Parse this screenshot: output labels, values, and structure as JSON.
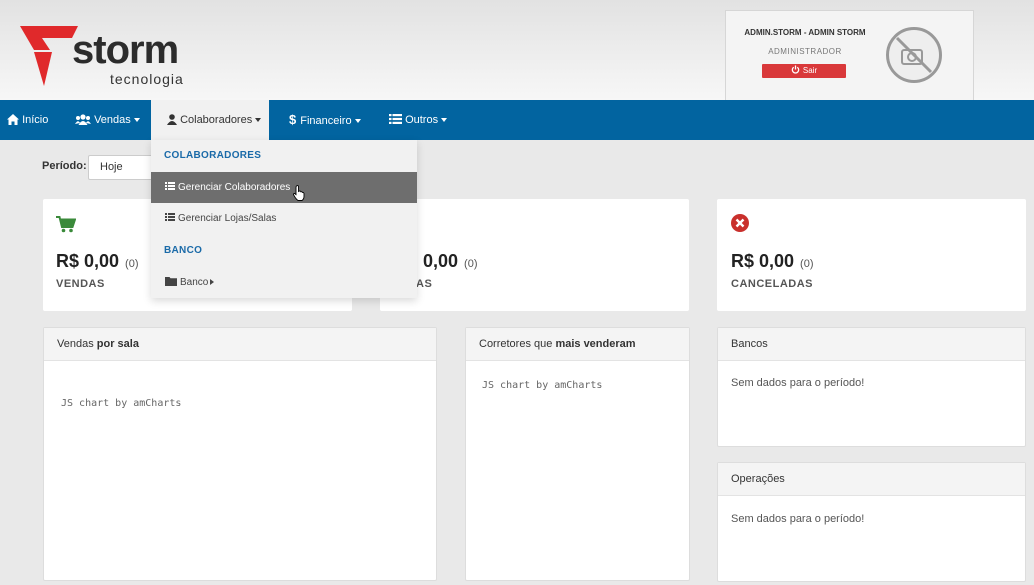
{
  "brand": {
    "name": "storm",
    "tagline": "tecnologia",
    "mark_color": "#e0292b"
  },
  "user": {
    "name": "ADMIN.STORM - ADMIN STORM",
    "role": "ADMINISTRADOR",
    "logout_label": "Sair"
  },
  "nav": {
    "items": [
      {
        "label": "Início",
        "icon": "home-icon"
      },
      {
        "label": "Vendas",
        "icon": "users-icon"
      },
      {
        "label": "Colaboradores",
        "icon": "user-icon",
        "open": true
      },
      {
        "label": "Financeiro",
        "icon": "dollar-icon"
      },
      {
        "label": "Outros",
        "icon": "list-icon"
      }
    ]
  },
  "dropdown": {
    "section1": "COLABORADORES",
    "item1": "Gerenciar Colaboradores",
    "item2": "Gerenciar Lojas/Salas",
    "section2": "BANCO",
    "item3": "Banco"
  },
  "period": {
    "label": "Período:",
    "value": "Hoje"
  },
  "stats": [
    {
      "value": "R$ 0,00",
      "count": "(0)",
      "label": "VENDAS",
      "icon": "cart-icon"
    },
    {
      "value": "0,00",
      "count": "(0)",
      "label": "AS"
    },
    {
      "value": "R$ 0,00",
      "count": "(0)",
      "label": "CANCELADAS",
      "icon": "cancel-icon"
    }
  ],
  "panels": {
    "sales_by_room": {
      "title_prefix": "Vendas ",
      "title_bold": "por sala",
      "body": "JS chart by amCharts"
    },
    "top_brokers": {
      "title_prefix": "Corretores que ",
      "title_bold": "mais venderam",
      "body": "JS chart by amCharts"
    },
    "banks": {
      "title": "Bancos",
      "body": "Sem dados para o período!"
    },
    "operations": {
      "title": "Operações",
      "body": "Sem dados para o período!"
    }
  },
  "colors": {
    "nav": "#0264a0",
    "accent_red": "#d9383a",
    "cart_green": "#3a8a3a",
    "section_blue": "#1a6aa8"
  }
}
